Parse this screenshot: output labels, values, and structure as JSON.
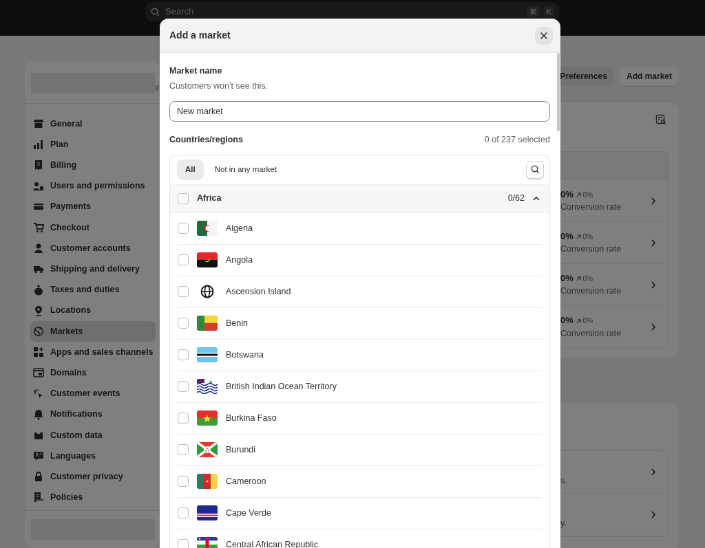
{
  "top_bar": {
    "search": {
      "placeholder": "Search"
    },
    "shortcut_keys": [
      "⌘",
      "K"
    ]
  },
  "sidebar": {
    "items": [
      {
        "label": "General",
        "selected": false
      },
      {
        "label": "Plan",
        "selected": false
      },
      {
        "label": "Billing",
        "selected": false
      },
      {
        "label": "Users and permissions",
        "selected": false
      },
      {
        "label": "Payments",
        "selected": false
      },
      {
        "label": "Checkout",
        "selected": false
      },
      {
        "label": "Customer accounts",
        "selected": false
      },
      {
        "label": "Shipping and delivery",
        "selected": false
      },
      {
        "label": "Taxes and duties",
        "selected": false
      },
      {
        "label": "Locations",
        "selected": false
      },
      {
        "label": "Markets",
        "selected": true
      },
      {
        "label": "Apps and sales channels",
        "selected": false
      },
      {
        "label": "Domains",
        "selected": false
      },
      {
        "label": "Customer events",
        "selected": false
      },
      {
        "label": "Notifications",
        "selected": false
      },
      {
        "label": "Custom data",
        "selected": false
      },
      {
        "label": "Languages",
        "selected": false
      },
      {
        "label": "Customer privacy",
        "selected": false
      },
      {
        "label": "Policies",
        "selected": false
      }
    ]
  },
  "header_fragment": "if",
  "header_buttons": [
    "Preferences",
    "Add market"
  ],
  "markets_card": {
    "rows": [
      {
        "rate": "0%",
        "change": "0%",
        "label": "Conversion rate"
      },
      {
        "rate": "0%",
        "change": "0%",
        "label": "Conversion rate"
      },
      {
        "rate": "0%",
        "change": "0%",
        "label": "Conversion rate"
      },
      {
        "rate": "0%",
        "change": "0%",
        "label": "Conversion rate"
      }
    ]
  },
  "second_card": {
    "rows": [
      {
        "text": "s."
      },
      {
        "text": "y."
      }
    ]
  },
  "modal": {
    "title": "Add a market",
    "market_name": {
      "label": "Market name",
      "hint": "Customers won’t see this.",
      "value": "New market"
    },
    "countries": {
      "label": "Countries/regions",
      "count": "0 of 237 selected"
    },
    "filters": [
      {
        "label": "All",
        "selected": true
      },
      {
        "label": "Not in any market",
        "selected": false
      }
    ],
    "region": {
      "name": "Africa",
      "count": "0/62",
      "checked": false,
      "expanded": true,
      "countries": [
        {
          "name": "Algeria",
          "checked": false
        },
        {
          "name": "Angola",
          "checked": false
        },
        {
          "name": "Ascension Island",
          "checked": false
        },
        {
          "name": "Benin",
          "checked": false
        },
        {
          "name": "Botswana",
          "checked": false
        },
        {
          "name": "British Indian Ocean Territory",
          "checked": false
        },
        {
          "name": "Burkina Faso",
          "checked": false
        },
        {
          "name": "Burundi",
          "checked": false
        },
        {
          "name": "Cameroon",
          "checked": false
        },
        {
          "name": "Cape Verde",
          "checked": false
        },
        {
          "name": "Central African Republic",
          "checked": false
        }
      ]
    }
  }
}
